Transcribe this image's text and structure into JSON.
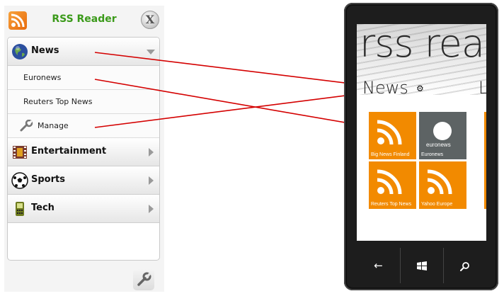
{
  "panel": {
    "title": "RSS Reader",
    "close_label": "X",
    "categories": [
      {
        "label": "News",
        "expanded": true
      },
      {
        "label": "Entertainment",
        "expanded": false
      },
      {
        "label": "Sports",
        "expanded": false
      },
      {
        "label": "Tech",
        "expanded": false
      }
    ],
    "news_items": [
      "Euronews",
      "Reuters Top News"
    ],
    "manage_label": "Manage"
  },
  "phone": {
    "hero_title": "rss rea",
    "section_title": "News",
    "next_section_peek": "L",
    "tiles": [
      {
        "label": "Big News Finland",
        "kind": "rss",
        "color": "#f28a00"
      },
      {
        "label": "Euronews",
        "kind": "euronews",
        "logo_text": "euronews",
        "color": "#5d6364"
      },
      {
        "label": "Reuters Top News",
        "kind": "rss",
        "color": "#f28a00"
      },
      {
        "label": "Yahoo Europe",
        "kind": "rss",
        "color": "#f28a00"
      }
    ],
    "nav": {
      "back_icon": "back-arrow-icon",
      "home_icon": "windows-logo-icon",
      "search_icon": "search-icon"
    }
  },
  "colors": {
    "arrow": "#d40000",
    "title_green": "#3b9a1a",
    "tile_orange": "#f28a00"
  }
}
